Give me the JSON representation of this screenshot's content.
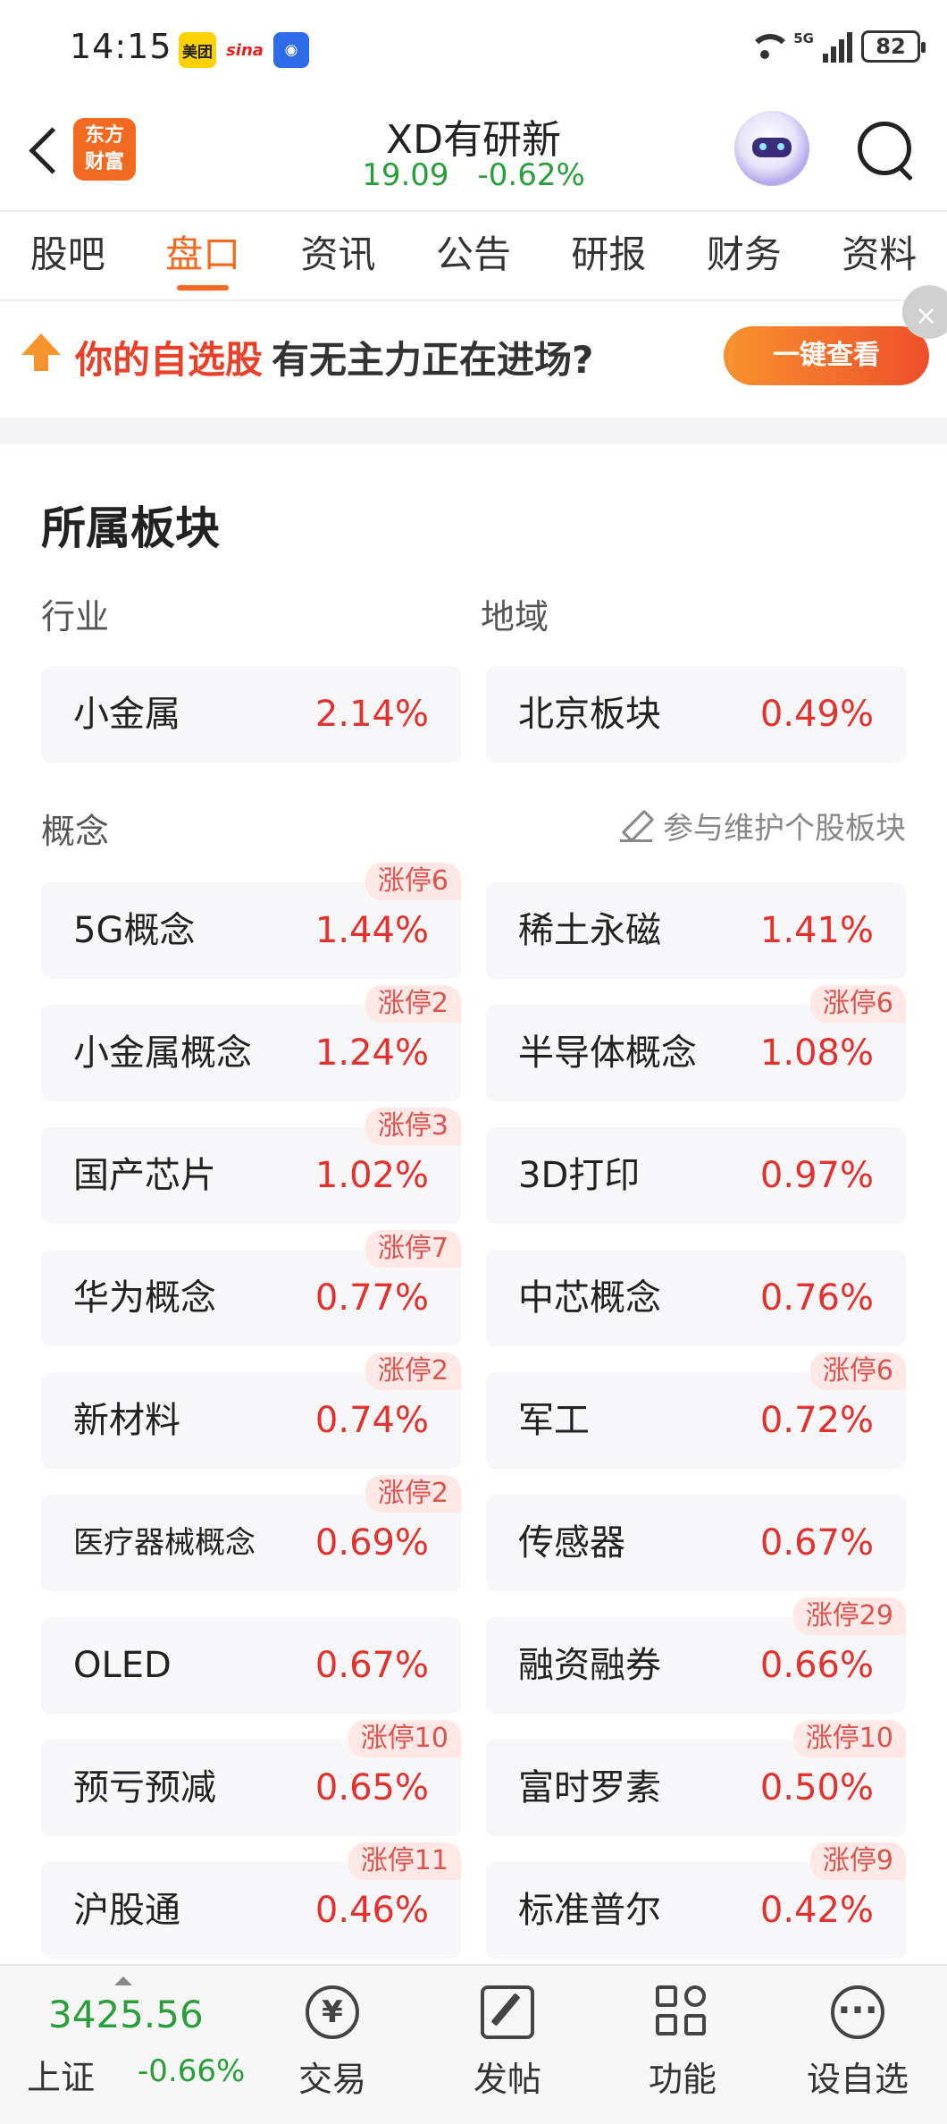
{
  "status_bar": {
    "time": "14:15",
    "app_badges": [
      "美团",
      "sina"
    ],
    "network": "5G",
    "battery": "82"
  },
  "header": {
    "stock_name": "XD有研新",
    "price": "19.09",
    "change": "-0.62%",
    "logo_text_line1": "东方",
    "logo_text_line2": "财富"
  },
  "tabs": [
    "股吧",
    "盘口",
    "资讯",
    "公告",
    "研报",
    "财务",
    "资料"
  ],
  "active_tab": "盘口",
  "banner": {
    "highlight": "你的自选股",
    "text": "有无主力正在进场?",
    "button": "一键查看"
  },
  "sectors": {
    "title": "所属板块",
    "industry_label": "行业",
    "region_label": "地域",
    "industry": {
      "name": "小金属",
      "pct": "2.14%"
    },
    "region": {
      "name": "北京板块",
      "pct": "0.49%"
    },
    "concept_label": "概念",
    "maintain_link": "参与维护个股板块",
    "concepts": [
      {
        "name": "5G概念",
        "pct": "1.44%",
        "tag": "涨停6"
      },
      {
        "name": "稀土永磁",
        "pct": "1.41%",
        "tag": ""
      },
      {
        "name": "小金属概念",
        "pct": "1.24%",
        "tag": "涨停2"
      },
      {
        "name": "半导体概念",
        "pct": "1.08%",
        "tag": "涨停6"
      },
      {
        "name": "国产芯片",
        "pct": "1.02%",
        "tag": "涨停3"
      },
      {
        "name": "3D打印",
        "pct": "0.97%",
        "tag": ""
      },
      {
        "name": "华为概念",
        "pct": "0.77%",
        "tag": "涨停7"
      },
      {
        "name": "中芯概念",
        "pct": "0.76%",
        "tag": ""
      },
      {
        "name": "新材料",
        "pct": "0.74%",
        "tag": "涨停2"
      },
      {
        "name": "军工",
        "pct": "0.72%",
        "tag": "涨停6"
      },
      {
        "name": "医疗器械概念",
        "pct": "0.69%",
        "tag": "涨停2"
      },
      {
        "name": "传感器",
        "pct": "0.67%",
        "tag": ""
      },
      {
        "name": "OLED",
        "pct": "0.67%",
        "tag": ""
      },
      {
        "name": "融资融券",
        "pct": "0.66%",
        "tag": "涨停29"
      },
      {
        "name": "预亏预减",
        "pct": "0.65%",
        "tag": "涨停10"
      },
      {
        "name": "富时罗素",
        "pct": "0.50%",
        "tag": "涨停10"
      },
      {
        "name": "沪股通",
        "pct": "0.46%",
        "tag": "涨停11"
      },
      {
        "name": "标准普尔",
        "pct": "0.42%",
        "tag": "涨停9"
      }
    ]
  },
  "bottom_bar": {
    "index_value": "3425.56",
    "index_name": "上证",
    "index_change": "-0.66%",
    "nav": [
      "交易",
      "发帖",
      "功能",
      "设自选"
    ],
    "trade_glyph": "¥"
  },
  "colors": {
    "accent": "#f26a21",
    "up": "#e0332f",
    "down": "#2a9d3c"
  }
}
